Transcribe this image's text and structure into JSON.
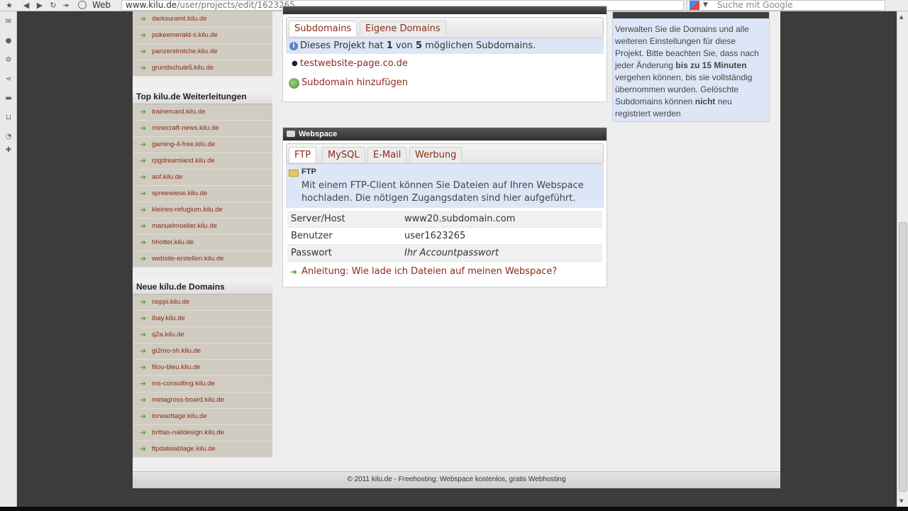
{
  "browser": {
    "web_label": "Web",
    "url_host": "www.kilu.de",
    "url_path": "/user/projects/edit/1623265",
    "search_placeholder": "Suche mit Google"
  },
  "sidebar": {
    "top_items": [
      "darksuramt.kilu.de",
      "pokeemerald-s.kilu.de",
      "panzerstrolche.kilu.de",
      "grundschule5.kilu.de"
    ],
    "weiterleitungen": {
      "title": "Top kilu.de Weiterleitungen",
      "items": [
        "trainercard.kilu.de",
        "minecraft-news.kilu.de",
        "gaming-4-free.kilu.de",
        "rpgdreamland.kilu.de",
        "aof.kilu.de",
        "spreewiese.kilu.de",
        "kleines-refugium.kilu.de",
        "manuelmoeller.kilu.de",
        "hhotter.kilu.de",
        "website-erstellen.kilu.de"
      ]
    },
    "neue_domains": {
      "title": "Neue kilu.de Domains",
      "items": [
        "noppi.kilu.de",
        "ibay.kilu.de",
        "q2a.kilu.de",
        "gi2mo-sh.kilu.de",
        "filou-bleu.kilu.de",
        "ms-consulting.kilu.de",
        "metagross-board.kilu.de",
        "torwarttage.kilu.de",
        "brittas-naildesign.kilu.de",
        "ftpdateiablage.kilu.de"
      ]
    }
  },
  "domains": {
    "tabs": [
      "Subdomains",
      "Eigene Domains"
    ],
    "info_prefix": "Dieses Projekt hat ",
    "info_count": "1",
    "info_mid": " von ",
    "info_max": "5",
    "info_suffix": " möglichen Subdomains.",
    "subdomain": "testwebsite-page.co.de",
    "add_label": "Subdomain hinzufügen"
  },
  "webspace": {
    "title": "Webspace",
    "tabs": [
      "FTP",
      "MySQL",
      "E-Mail",
      "Werbung"
    ],
    "section_title": "FTP",
    "description": "Mit einem FTP-Client können Sie Dateien auf Ihren Webspace hochladen. Die nötigen Zugangsdaten sind hier aufgeführt.",
    "rows": [
      {
        "key": "Server/Host",
        "value": "www20.subdomain.com"
      },
      {
        "key": "Benutzer",
        "value": "user1623265"
      },
      {
        "key": "Passwort",
        "value": "Ihr Accountpasswort"
      }
    ],
    "help_link": "Anleitung: Wie lade ich Dateien auf meinen Webspace?"
  },
  "info_box": {
    "text_1": "Verwalten Sie die Domains und alle weiteren Einstellungen für diese Projekt. Bitte beachten Sie, dass nach jeder Änderung ",
    "bold_1": "bis zu 15 Minuten",
    "text_2": " vergehen können, bis sie vollständig übernommen wurden. Gelöschte Subdomains können ",
    "bold_2": "nicht",
    "text_3": " neu registriert werden"
  },
  "footer": "© 2011 kilu.de - Freehosting: Webspace kostenlos, gratis Webhosting"
}
